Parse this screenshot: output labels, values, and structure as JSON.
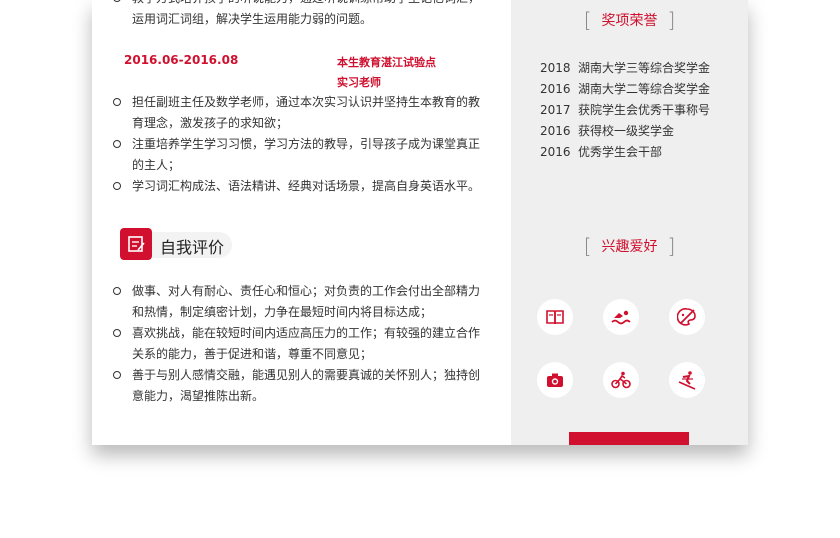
{
  "experience": {
    "top_item_lines": [
      "教学方式培养孩子的听说能力，通过听说训练帮助学生记忆词汇，",
      "运用词汇词组，解决学生运用能力弱的问题。"
    ],
    "date": "2016.06-2016.08",
    "org_line1": "本生教育湛江试验点",
    "org_line2": "实习老师",
    "items": [
      [
        "担任副班主任及数学老师，通过本次实习认识并坚持生本教育的教",
        "育理念，激发孩子的求知欲；"
      ],
      [
        "注重培养学生学习习惯，学习方法的教导，引导孩子成为课堂真正",
        "的主人；"
      ],
      [
        "学习词汇构成法、语法精讲、经典对话场景，提高自身英语水平。"
      ]
    ]
  },
  "self_eval": {
    "title": "自我评价",
    "items": [
      [
        "做事、对人有耐心、责任心和恒心；对负责的工作会付出全部精力",
        "和热情，制定缜密计划，力争在最短时间内将目标达成；"
      ],
      [
        "喜欢挑战，能在较短时间内适应高压力的工作；有较强的建立合作",
        "关系的能力，善于促进和谐，尊重不同意见；"
      ],
      [
        "善于与别人感情交融，能遇见别人的需要真诚的关怀别人；独持创",
        "意能力，渴望推陈出新。"
      ]
    ]
  },
  "awards": {
    "title": "奖项荣誉",
    "list": [
      {
        "year": "2018",
        "name": "湖南大学三等综合奖学金"
      },
      {
        "year": "2016",
        "name": "湖南大学二等综合奖学金"
      },
      {
        "year": "2017",
        "name": "获院学生会优秀干事称号"
      },
      {
        "year": "2016",
        "name": "获得校一级奖学金"
      },
      {
        "year": "2016",
        "name": "优秀学生会干部"
      }
    ]
  },
  "hobbies": {
    "title": "兴趣爱好",
    "icons": [
      "book-icon",
      "swimming-icon",
      "painting-icon",
      "camera-icon",
      "cycling-icon",
      "skiing-icon"
    ]
  },
  "colors": {
    "accent": "#d0102e",
    "side_bg": "#efefef"
  }
}
